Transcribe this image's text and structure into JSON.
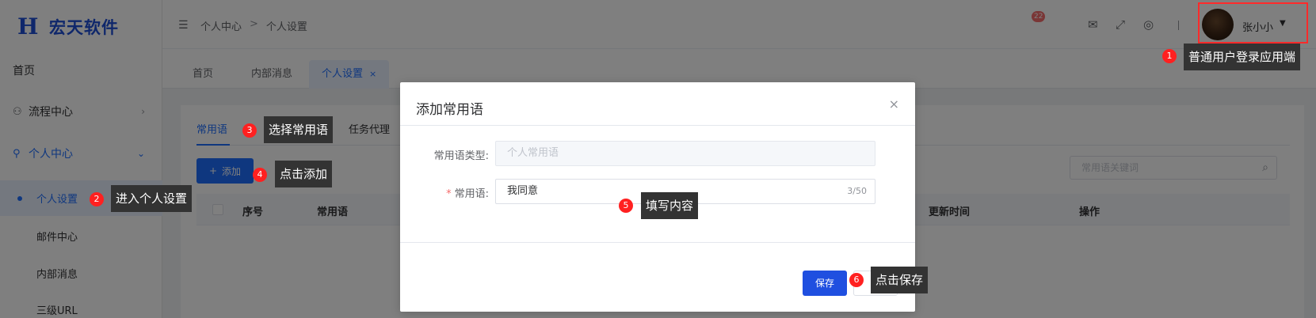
{
  "app": {
    "logo_mark": "H",
    "name": "宏天软件"
  },
  "sidebar": {
    "home": "首页",
    "process_center": "流程中心",
    "personal_center": "个人中心",
    "personal_settings": "个人设置",
    "mail_center": "邮件中心",
    "internal_messages": "内部消息",
    "third_level": "三级URL"
  },
  "header": {
    "breadcrumb": [
      "个人中心",
      "个人设置"
    ],
    "breadcrumb_sep": ">",
    "message_badge": "22",
    "username": "张小小"
  },
  "tabs": [
    {
      "label": "首页"
    },
    {
      "label": "内部消息"
    },
    {
      "label": "个人设置",
      "close": "×"
    }
  ],
  "content": {
    "inner_tabs": [
      "常用语",
      "任务代理"
    ],
    "add_button": "添加",
    "add_icon": "+",
    "search_placeholder": "常用语关键词",
    "columns": [
      "序号",
      "常用语",
      "更新时间",
      "操作"
    ]
  },
  "dialog": {
    "title": "添加常用语",
    "close": "×",
    "type_label": "常用语类型:",
    "type_value": "个人常用语",
    "phrase_label": "常用语:",
    "required_mark": "*",
    "phrase_value": "我同意",
    "counter": "3/50",
    "save": "保存"
  },
  "annotations": [
    {
      "num": "1",
      "text": "普通用户登录应用端"
    },
    {
      "num": "2",
      "text": "进入个人设置"
    },
    {
      "num": "3",
      "text": "选择常用语"
    },
    {
      "num": "4",
      "text": "点击添加"
    },
    {
      "num": "5",
      "text": "填写内容"
    },
    {
      "num": "6",
      "text": "点击保存"
    }
  ],
  "colors": {
    "primary": "#1f6fff",
    "annotation_badge": "#ff2020",
    "annotation_box": "#333333",
    "highlight_border": "#ff2a2a"
  }
}
